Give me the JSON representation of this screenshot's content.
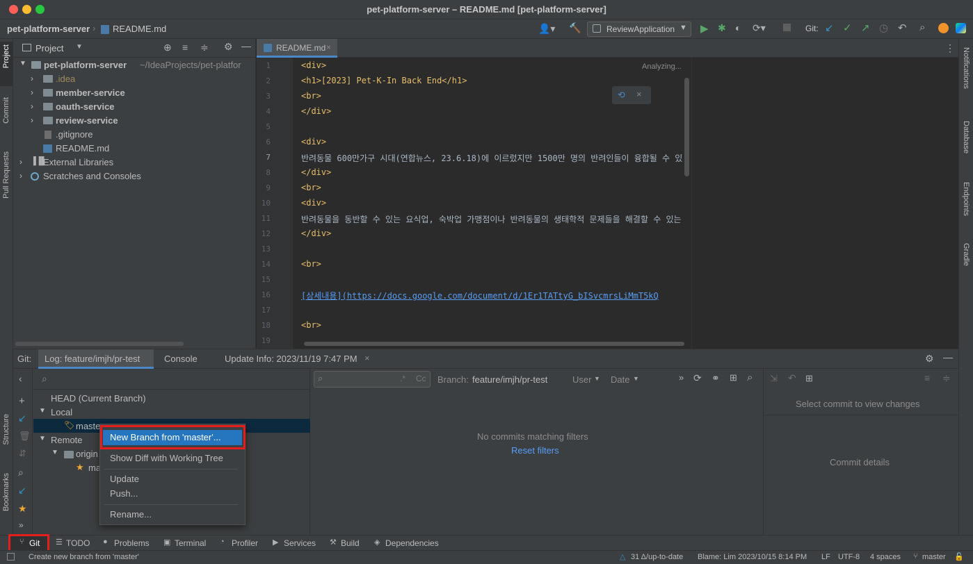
{
  "window": {
    "title": "pet-platform-server – README.md [pet-platform-server]"
  },
  "nav": {
    "project": "pet-platform-server",
    "file": "README.md",
    "run_config": "ReviewApplication",
    "git_label": "Git:"
  },
  "left_strip": {
    "project": "Project",
    "commit": "Commit",
    "pull_requests": "Pull Requests",
    "structure": "Structure",
    "bookmarks": "Bookmarks"
  },
  "right_strip": {
    "notifications": "Notifications",
    "database": "Database",
    "endpoints": "Endpoints",
    "gradle": "Gradle"
  },
  "project_panel": {
    "title": "Project",
    "root": "pet-platform-server",
    "root_path": "~/IdeaProjects/pet-platfor",
    "items": [
      {
        "label": ".idea"
      },
      {
        "label": "member-service"
      },
      {
        "label": "oauth-service"
      },
      {
        "label": "review-service"
      },
      {
        "label": ".gitignore"
      },
      {
        "label": "README.md"
      },
      {
        "label": "External Libraries"
      },
      {
        "label": "Scratches and Consoles"
      }
    ]
  },
  "editor": {
    "tab": "README.md",
    "status": "Analyzing...",
    "lines": [
      {
        "n": "1",
        "text": "<div>"
      },
      {
        "n": "2",
        "text": "<h1>[2023] Pet-K-In Back End</h1>"
      },
      {
        "n": "3",
        "text": "<br>"
      },
      {
        "n": "4",
        "text": "</div>"
      },
      {
        "n": "5",
        "text": ""
      },
      {
        "n": "6",
        "text": "<div>"
      },
      {
        "n": "7",
        "text": "반려동물 600만가구 시대(연합뉴스, 23.6.18)에 이르렀지만 1500만 명의 반려인들이 융합될 수 있"
      },
      {
        "n": "8",
        "text": "</div>"
      },
      {
        "n": "9",
        "text": "<br>"
      },
      {
        "n": "10",
        "text": "<div>"
      },
      {
        "n": "11",
        "text": "반려동물을 동반할 수 있는 요식업, 숙박업 가맹점이나 반려동물의 생태학적 문제들을 해결할 수 있는"
      },
      {
        "n": "12",
        "text": "</div>"
      },
      {
        "n": "13",
        "text": ""
      },
      {
        "n": "14",
        "text": "<br>"
      },
      {
        "n": "15",
        "text": ""
      },
      {
        "n": "16",
        "text": "[상세내용](https://docs.google.com/document/d/1Er1TATtyG_bISvcmrsLiMmT5kQ"
      },
      {
        "n": "17",
        "text": ""
      },
      {
        "n": "18",
        "text": "<br>"
      },
      {
        "n": "19",
        "text": ""
      }
    ]
  },
  "bottom": {
    "git_label": "Git:",
    "tabs": [
      "Log: feature/imjh/pr-test",
      "Console",
      "Update Info: 2023/11/19 7:47 PM"
    ],
    "branches": {
      "head": "HEAD (Current Branch)",
      "local": "Local",
      "master": "master",
      "remote": "Remote",
      "origin": "origin",
      "origin_master": "ma"
    },
    "filter": {
      "branch_label": "Branch:",
      "branch_value": "feature/imjh/pr-test",
      "user": "User",
      "date": "Date",
      "cc": "Cc"
    },
    "empty": "No commits matching filters",
    "reset": "Reset filters",
    "select_commit": "Select commit to view changes",
    "commit_details": "Commit details"
  },
  "context_menu": {
    "items": [
      "New Branch from 'master'...",
      "Show Diff with Working Tree",
      "Update",
      "Push...",
      "Rename..."
    ]
  },
  "tool_windows": [
    "Git",
    "TODO",
    "Problems",
    "Terminal",
    "Profiler",
    "Services",
    "Build",
    "Dependencies"
  ],
  "status": {
    "message": "Create new branch from 'master'",
    "vcs": "31 Δ/up-to-date",
    "blame": "Blame: Lim 2023/10/15 8:14 PM",
    "eol": "LF",
    "encoding": "UTF-8",
    "indent": "4 spaces",
    "branch": "master"
  }
}
